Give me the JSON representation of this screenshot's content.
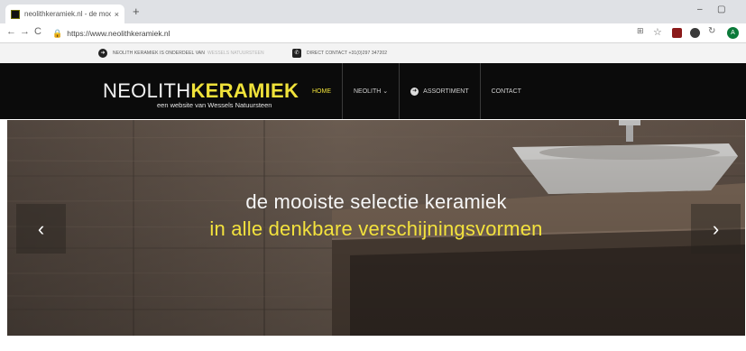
{
  "browser": {
    "tab_title": "neolithkeramiek.nl - de mooiste",
    "tab_close": "×",
    "new_tab": "+",
    "url": "https://www.neolithkeramiek.nl",
    "back": "←",
    "forward": "→",
    "reload": "C",
    "lock": "🔒",
    "minimize": "–",
    "maximize": "▢",
    "more": "⋮",
    "star": "☆",
    "avatar_initial": "A"
  },
  "infobar": {
    "text1": "NEOLITH KERAMIEK IS ONDERDEEL VAN",
    "link1": "WESSELS NATUURSTEEN",
    "text2": "DIRECT CONTACT +31(0)297 347202"
  },
  "site": {
    "logo_part1": "NEOLITH",
    "logo_part2": "KERAMIEK",
    "logo_sub": "een website van Wessels Natuursteen",
    "menu": {
      "home": "HOME",
      "neolith": "NEOLITH",
      "neolith_caret": "⌄",
      "assortiment": "ASSORTIMENT",
      "contact": "CONTACT"
    }
  },
  "hero": {
    "line1": "de mooiste selectie keramiek",
    "line2": "in alle denkbare verschijningsvormen",
    "prev": "‹",
    "next": "›"
  },
  "colors": {
    "accent": "#f0e23a",
    "header_bg": "#0b0b0b"
  }
}
